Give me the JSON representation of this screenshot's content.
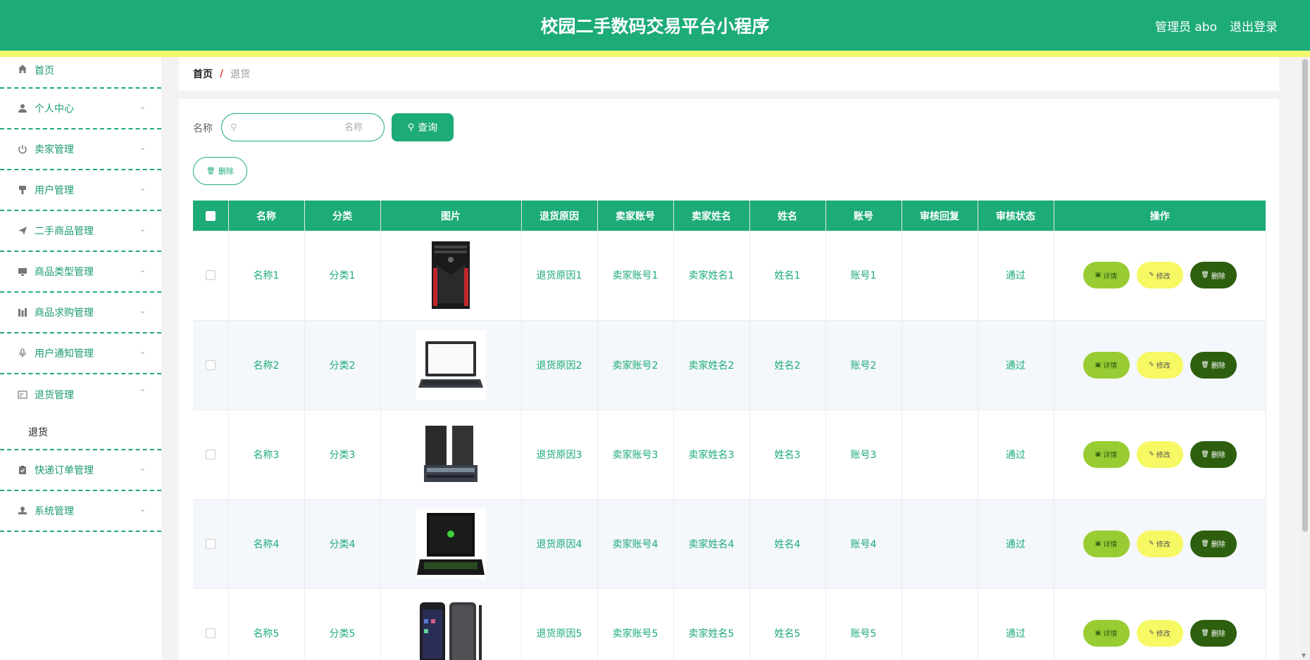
{
  "header": {
    "title": "校园二手数码交易平台小程序",
    "admin": "管理员 abo",
    "logout": "退出登录"
  },
  "sidebar": {
    "items": [
      {
        "label": "首页",
        "icon": "home-icon",
        "has_children": false
      },
      {
        "label": "个人中心",
        "icon": "user-icon",
        "has_children": true
      },
      {
        "label": "卖家管理",
        "icon": "power-icon",
        "has_children": true
      },
      {
        "label": "用户管理",
        "icon": "brush-icon",
        "has_children": true
      },
      {
        "label": "二手商品管理",
        "icon": "send-icon",
        "has_children": true
      },
      {
        "label": "商品类型管理",
        "icon": "monitor-icon",
        "has_children": true
      },
      {
        "label": "商品求购管理",
        "icon": "chart-icon",
        "has_children": true
      },
      {
        "label": "用户通知管理",
        "icon": "microphone-icon",
        "has_children": true
      },
      {
        "label": "退货管理",
        "icon": "card-icon",
        "has_children": true,
        "open": true,
        "submenu": [
          "退货"
        ]
      },
      {
        "label": "快递订单管理",
        "icon": "clipboard-icon",
        "has_children": true
      },
      {
        "label": "系统管理",
        "icon": "stamp-icon",
        "has_children": true
      }
    ]
  },
  "breadcrumb": {
    "home": "首页",
    "separator": "/",
    "current": "退货"
  },
  "search": {
    "label": "名称",
    "placeholder": "名称",
    "button": "查询"
  },
  "toolbar": {
    "delete_label": "删除"
  },
  "table": {
    "headers": [
      "名称",
      "分类",
      "图片",
      "退货原因",
      "卖家账号",
      "卖家姓名",
      "姓名",
      "账号",
      "审核回复",
      "审核状态",
      "操作"
    ],
    "rows": [
      {
        "name": "名称1",
        "category": "分类1",
        "image": "pc-tower",
        "reason": "退货原因1",
        "seller_account": "卖家账号1",
        "seller_name": "卖家姓名1",
        "person_name": "姓名1",
        "account": "账号1",
        "reply": "",
        "status": "通过"
      },
      {
        "name": "名称2",
        "category": "分类2",
        "image": "laptop",
        "reason": "退货原因2",
        "seller_account": "卖家账号2",
        "seller_name": "卖家姓名2",
        "person_name": "姓名2",
        "account": "账号2",
        "reply": "",
        "status": "通过"
      },
      {
        "name": "名称3",
        "category": "分类3",
        "image": "speakers",
        "reason": "退货原因3",
        "seller_account": "卖家账号3",
        "seller_name": "卖家姓名3",
        "person_name": "姓名3",
        "account": "账号3",
        "reply": "",
        "status": "通过"
      },
      {
        "name": "名称4",
        "category": "分类4",
        "image": "gaming-laptop",
        "reason": "退货原因4",
        "seller_account": "卖家账号4",
        "seller_name": "卖家姓名4",
        "person_name": "姓名4",
        "account": "账号4",
        "reply": "",
        "status": "通过"
      },
      {
        "name": "名称5",
        "category": "分类5",
        "image": "phones",
        "reason": "退货原因5",
        "seller_account": "卖家账号5",
        "seller_name": "卖家姓名5",
        "person_name": "姓名5",
        "account": "账号5",
        "reply": "",
        "status": "通过"
      }
    ],
    "actions": {
      "detail": "详情",
      "edit": "修改",
      "delete": "删除"
    }
  },
  "colors": {
    "primary": "#1dab78",
    "accent_yellow": "#f5f76b",
    "detail_btn": "#99cc33",
    "edit_btn": "#f6f864",
    "delete_btn": "#2d5f0f"
  }
}
